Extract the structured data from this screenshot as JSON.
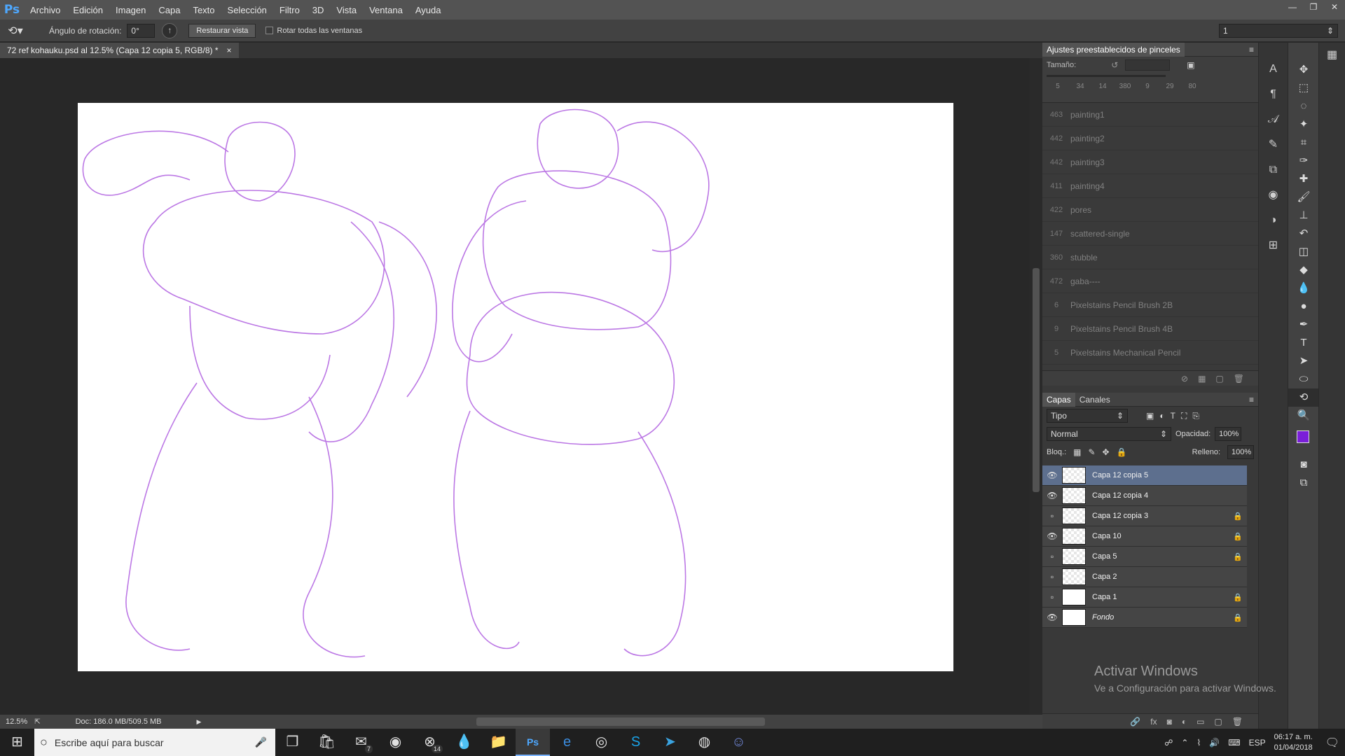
{
  "menubar": {
    "app_logo": "Ps",
    "items": [
      "Archivo",
      "Edición",
      "Imagen",
      "Capa",
      "Texto",
      "Selección",
      "Filtro",
      "3D",
      "Vista",
      "Ventana",
      "Ayuda"
    ],
    "window_controls": [
      "minimize-icon",
      "restore-icon",
      "close-icon"
    ]
  },
  "options": {
    "rotation_label": "Ángulo de rotación:",
    "rotation_value": "0°",
    "reset_button": "Restaurar vista",
    "rotate_all_label": "Rotar todas las ventanas",
    "workspace_value": "1"
  },
  "document": {
    "tab_title": "72 ref kohauku.psd al 12.5% (Capa 12 copia 5, RGB/8) *",
    "tab_close": "×"
  },
  "status": {
    "zoom": "12.5%",
    "doc_info": "Doc: 186.0 MB/509.5 MB"
  },
  "brush_presets": {
    "title": "Ajustes preestablecidos de pinceles",
    "size_label": "Tamaño:",
    "quick_sizes": [
      "5",
      "34",
      "14",
      "380",
      "9",
      "29",
      "80"
    ],
    "items": [
      {
        "size": "463",
        "name": "painting1"
      },
      {
        "size": "442",
        "name": "painting2"
      },
      {
        "size": "442",
        "name": "painting3"
      },
      {
        "size": "411",
        "name": "painting4"
      },
      {
        "size": "422",
        "name": "pores"
      },
      {
        "size": "147",
        "name": "scattered-single"
      },
      {
        "size": "360",
        "name": "stubble"
      },
      {
        "size": "472",
        "name": "gaba----"
      },
      {
        "size": "6",
        "name": "Pixelstains Pencil Brush 2B"
      },
      {
        "size": "9",
        "name": "Pixelstains Pencil Brush 4B"
      },
      {
        "size": "5",
        "name": "Pixelstains Mechanical Pencil"
      }
    ]
  },
  "layers_panel": {
    "tabs": [
      "Capas",
      "Canales"
    ],
    "filter_kind": "Tipo",
    "blend_mode": "Normal",
    "opacity_label": "Opacidad:",
    "opacity_value": "100%",
    "lock_label": "Bloq.:",
    "fill_label": "Relleno:",
    "fill_value": "100%",
    "layers": [
      {
        "name": "Capa 12 copia 5",
        "visible": true,
        "locked": false,
        "selected": true
      },
      {
        "name": "Capa 12 copia 4",
        "visible": true,
        "locked": false,
        "selected": false
      },
      {
        "name": "Capa 12 copia 3",
        "visible": false,
        "locked": true,
        "selected": false
      },
      {
        "name": "Capa 10",
        "visible": true,
        "locked": true,
        "selected": false
      },
      {
        "name": "Capa 5",
        "visible": false,
        "locked": true,
        "selected": false
      },
      {
        "name": "Capa 2",
        "visible": false,
        "locked": false,
        "selected": false
      },
      {
        "name": "Capa 1",
        "visible": false,
        "locked": true,
        "selected": false
      },
      {
        "name": "Fondo",
        "visible": true,
        "locked": true,
        "selected": false
      }
    ]
  },
  "watermark": {
    "title": "Activar Windows",
    "subtitle": "Ve a Configuración para activar Windows."
  },
  "taskbar": {
    "search_placeholder": "Escribe aquí para buscar",
    "language": "ESP",
    "time": "06:17 a. m.",
    "date": "01/04/2018",
    "badge_mail": "7",
    "badge_xbox": "14"
  },
  "colors": {
    "foreground": "#7a1fd8",
    "background": "#ffffff",
    "sketch": "#b060e0",
    "selected_layer": "#5d6f8e"
  }
}
